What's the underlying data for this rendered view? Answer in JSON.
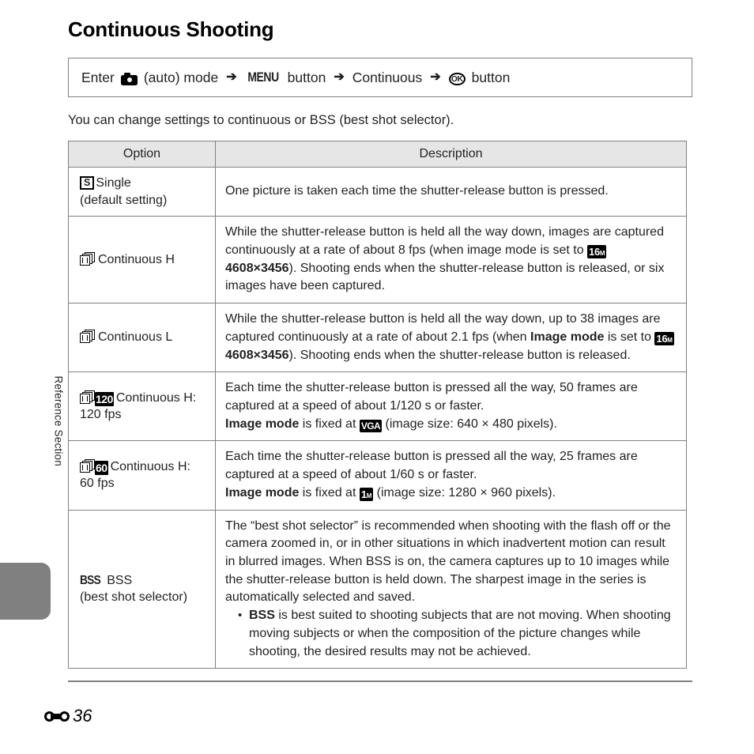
{
  "side": {
    "section_label": "Reference Section"
  },
  "header": {
    "title": "Continuous Shooting"
  },
  "path": {
    "enter": "Enter",
    "camera_icon": "camera-auto-mode-icon",
    "auto_mode": "(auto) mode",
    "arrow": "➔",
    "menu_glyph": "MENU",
    "menu_button": "button",
    "continuous": "Continuous",
    "ok_glyph": "OK",
    "ok_button": "button"
  },
  "intro": "You can change settings to continuous or BSS (best shot selector).",
  "table": {
    "headers": {
      "option": "Option",
      "description": "Description"
    },
    "rows": [
      {
        "icon": "single-frame-icon",
        "icon_text": "S",
        "option_line1": "Single",
        "option_line2": "(default setting)",
        "description": "One picture is taken each time the shutter-release button is pressed."
      },
      {
        "icon": "continuous-stack-icon",
        "option_line1": "Continuous H",
        "desc_part1": "While the shutter-release button is held all the way down, images are captured continuously at a rate of about 8 fps (when image mode is set to ",
        "badge": "16",
        "badge_sub": "M",
        "desc_bold": "4608×3456",
        "desc_part2": "). Shooting ends when the shutter-release button is released, or six images have been captured."
      },
      {
        "icon": "continuous-stack-icon",
        "option_line1": "Continuous L",
        "desc_part1": "While the shutter-release button is held all the way down, up to 38 images are captured continuously at a rate of about 2.1 fps (when ",
        "desc_bold1": "Image mode",
        "desc_part2": " is set to ",
        "badge": "16",
        "badge_sub": "M",
        "desc_bold2": "4608×3456",
        "desc_part3": "). Shooting ends when the shutter-release button is released."
      },
      {
        "icon": "continuous-120-icon",
        "fps_badge": "120",
        "option_line1": "Continuous H:",
        "option_line2": "120 fps",
        "desc_part1": "Each time the shutter-release button is pressed all the way, 50 frames are captured at a speed of about 1/120 s or faster.",
        "desc_bold1": "Image mode",
        "desc_part2": " is fixed at ",
        "badge": "VGA",
        "desc_part3": " (image size: 640 × 480 pixels)."
      },
      {
        "icon": "continuous-60-icon",
        "fps_badge": "60",
        "option_line1": "Continuous H:",
        "option_line2": "60 fps",
        "desc_part1": "Each time the shutter-release button is pressed all the way, 25 frames are captured at a speed of about 1/60 s or faster.",
        "desc_bold1": "Image mode",
        "desc_part2": " is fixed at ",
        "badge": "1",
        "badge_sub": "M",
        "desc_part3": " (image size: 1280 × 960 pixels)."
      },
      {
        "icon": "bss-icon",
        "icon_text": "BSS",
        "option_line1": "BSS",
        "option_line2": "(best shot selector)",
        "desc_part1": "The “best shot selector” is recommended when shooting with the flash off or the camera zoomed in, or in other situations in which inadvertent motion can result in blurred images. When BSS is on, the camera captures up to 10 images while the shutter-release button is held down. The sharpest image in the series is automatically selected and saved.",
        "bullet_bold": "BSS",
        "bullet_text": " is best suited to shooting subjects that are not moving. When shooting moving subjects or when the composition of the picture changes while shooting, the desired results may not be achieved."
      }
    ]
  },
  "footer": {
    "section_glyph": "reference-section-icon",
    "page_number": "36"
  }
}
